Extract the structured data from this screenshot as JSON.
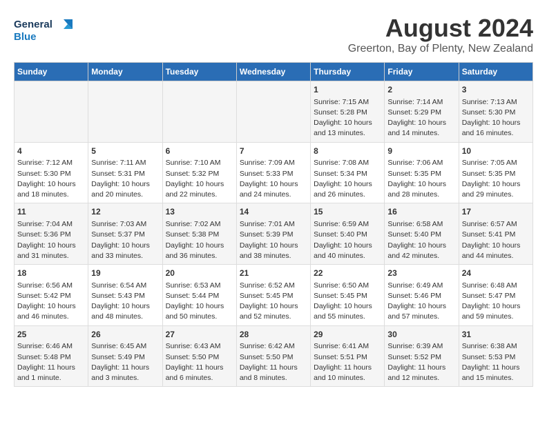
{
  "logo": {
    "line1": "General",
    "line2": "Blue"
  },
  "title": "August 2024",
  "subtitle": "Greerton, Bay of Plenty, New Zealand",
  "header": {
    "columns": [
      "Sunday",
      "Monday",
      "Tuesday",
      "Wednesday",
      "Thursday",
      "Friday",
      "Saturday"
    ]
  },
  "weeks": [
    {
      "days": [
        {
          "num": "",
          "content": ""
        },
        {
          "num": "",
          "content": ""
        },
        {
          "num": "",
          "content": ""
        },
        {
          "num": "",
          "content": ""
        },
        {
          "num": "1",
          "content": "Sunrise: 7:15 AM\nSunset: 5:28 PM\nDaylight: 10 hours\nand 13 minutes."
        },
        {
          "num": "2",
          "content": "Sunrise: 7:14 AM\nSunset: 5:29 PM\nDaylight: 10 hours\nand 14 minutes."
        },
        {
          "num": "3",
          "content": "Sunrise: 7:13 AM\nSunset: 5:30 PM\nDaylight: 10 hours\nand 16 minutes."
        }
      ]
    },
    {
      "days": [
        {
          "num": "4",
          "content": "Sunrise: 7:12 AM\nSunset: 5:30 PM\nDaylight: 10 hours\nand 18 minutes."
        },
        {
          "num": "5",
          "content": "Sunrise: 7:11 AM\nSunset: 5:31 PM\nDaylight: 10 hours\nand 20 minutes."
        },
        {
          "num": "6",
          "content": "Sunrise: 7:10 AM\nSunset: 5:32 PM\nDaylight: 10 hours\nand 22 minutes."
        },
        {
          "num": "7",
          "content": "Sunrise: 7:09 AM\nSunset: 5:33 PM\nDaylight: 10 hours\nand 24 minutes."
        },
        {
          "num": "8",
          "content": "Sunrise: 7:08 AM\nSunset: 5:34 PM\nDaylight: 10 hours\nand 26 minutes."
        },
        {
          "num": "9",
          "content": "Sunrise: 7:06 AM\nSunset: 5:35 PM\nDaylight: 10 hours\nand 28 minutes."
        },
        {
          "num": "10",
          "content": "Sunrise: 7:05 AM\nSunset: 5:35 PM\nDaylight: 10 hours\nand 29 minutes."
        }
      ]
    },
    {
      "days": [
        {
          "num": "11",
          "content": "Sunrise: 7:04 AM\nSunset: 5:36 PM\nDaylight: 10 hours\nand 31 minutes."
        },
        {
          "num": "12",
          "content": "Sunrise: 7:03 AM\nSunset: 5:37 PM\nDaylight: 10 hours\nand 33 minutes."
        },
        {
          "num": "13",
          "content": "Sunrise: 7:02 AM\nSunset: 5:38 PM\nDaylight: 10 hours\nand 36 minutes."
        },
        {
          "num": "14",
          "content": "Sunrise: 7:01 AM\nSunset: 5:39 PM\nDaylight: 10 hours\nand 38 minutes."
        },
        {
          "num": "15",
          "content": "Sunrise: 6:59 AM\nSunset: 5:40 PM\nDaylight: 10 hours\nand 40 minutes."
        },
        {
          "num": "16",
          "content": "Sunrise: 6:58 AM\nSunset: 5:40 PM\nDaylight: 10 hours\nand 42 minutes."
        },
        {
          "num": "17",
          "content": "Sunrise: 6:57 AM\nSunset: 5:41 PM\nDaylight: 10 hours\nand 44 minutes."
        }
      ]
    },
    {
      "days": [
        {
          "num": "18",
          "content": "Sunrise: 6:56 AM\nSunset: 5:42 PM\nDaylight: 10 hours\nand 46 minutes."
        },
        {
          "num": "19",
          "content": "Sunrise: 6:54 AM\nSunset: 5:43 PM\nDaylight: 10 hours\nand 48 minutes."
        },
        {
          "num": "20",
          "content": "Sunrise: 6:53 AM\nSunset: 5:44 PM\nDaylight: 10 hours\nand 50 minutes."
        },
        {
          "num": "21",
          "content": "Sunrise: 6:52 AM\nSunset: 5:45 PM\nDaylight: 10 hours\nand 52 minutes."
        },
        {
          "num": "22",
          "content": "Sunrise: 6:50 AM\nSunset: 5:45 PM\nDaylight: 10 hours\nand 55 minutes."
        },
        {
          "num": "23",
          "content": "Sunrise: 6:49 AM\nSunset: 5:46 PM\nDaylight: 10 hours\nand 57 minutes."
        },
        {
          "num": "24",
          "content": "Sunrise: 6:48 AM\nSunset: 5:47 PM\nDaylight: 10 hours\nand 59 minutes."
        }
      ]
    },
    {
      "days": [
        {
          "num": "25",
          "content": "Sunrise: 6:46 AM\nSunset: 5:48 PM\nDaylight: 11 hours\nand 1 minute."
        },
        {
          "num": "26",
          "content": "Sunrise: 6:45 AM\nSunset: 5:49 PM\nDaylight: 11 hours\nand 3 minutes."
        },
        {
          "num": "27",
          "content": "Sunrise: 6:43 AM\nSunset: 5:50 PM\nDaylight: 11 hours\nand 6 minutes."
        },
        {
          "num": "28",
          "content": "Sunrise: 6:42 AM\nSunset: 5:50 PM\nDaylight: 11 hours\nand 8 minutes."
        },
        {
          "num": "29",
          "content": "Sunrise: 6:41 AM\nSunset: 5:51 PM\nDaylight: 11 hours\nand 10 minutes."
        },
        {
          "num": "30",
          "content": "Sunrise: 6:39 AM\nSunset: 5:52 PM\nDaylight: 11 hours\nand 12 minutes."
        },
        {
          "num": "31",
          "content": "Sunrise: 6:38 AM\nSunset: 5:53 PM\nDaylight: 11 hours\nand 15 minutes."
        }
      ]
    }
  ]
}
